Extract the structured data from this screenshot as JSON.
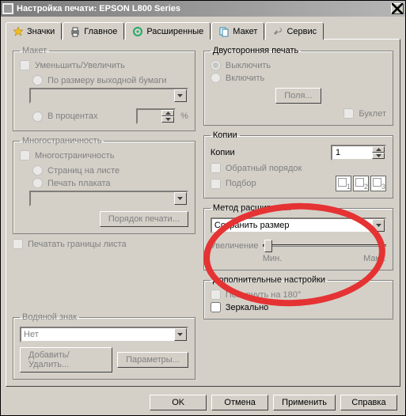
{
  "title": "Настройка печати: EPSON L800 Series",
  "tabs": [
    {
      "label": "Значки"
    },
    {
      "label": "Главное"
    },
    {
      "label": "Расширенные"
    },
    {
      "label": "Макет"
    },
    {
      "label": "Сервис"
    }
  ],
  "layout": {
    "legend": "Макет",
    "reduce_enlarge": "Уменьшить/Увеличить",
    "by_output": "По размеру выходной бумаги",
    "percent": "В процентах",
    "percent_suffix": "%"
  },
  "multipage": {
    "legend": "Многостраничность",
    "pages_per_sheet": "Страниц на листе",
    "poster": "Печать плаката",
    "print_order": "Порядок печати..."
  },
  "print_borders": "Печатать границы листа",
  "watermark": {
    "legend": "Водяной знак",
    "value": "Нет",
    "add_remove": "Добавить/Удалить...",
    "params": "Параметры..."
  },
  "duplex": {
    "legend": "Двусторонняя печать",
    "off": "Выключить",
    "on": "Включить",
    "margins": "Поля...",
    "booklet": "Буклет"
  },
  "copies": {
    "legend": "Копии",
    "label": "Копии",
    "value": "1",
    "reverse": "Обратный порядок",
    "collate": "Подбор",
    "icon1": "1",
    "icon2": "2",
    "icon3": "3"
  },
  "expand": {
    "legend": "Метод расширения",
    "value": "Сохранить размер",
    "zoom": "Увеличение",
    "min": "Мин.",
    "max": "Макс."
  },
  "more": {
    "legend": "Дополнительные настройки",
    "rotate": "Повернуть на 180°",
    "mirror": "Зеркально"
  },
  "buttons": {
    "ok": "OK",
    "cancel": "Отмена",
    "apply": "Применить",
    "help": "Справка"
  }
}
